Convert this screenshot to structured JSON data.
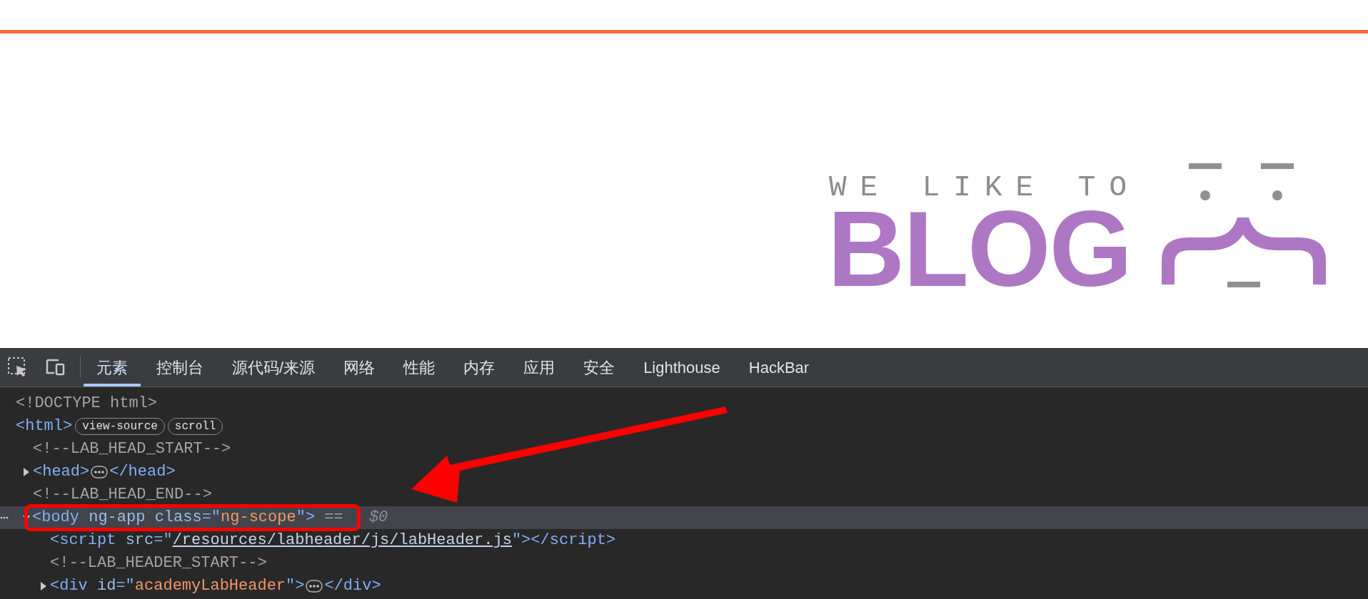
{
  "page": {
    "logo": {
      "tagline": "WE LIKE TO",
      "word": "BLOG"
    }
  },
  "devtools": {
    "tabs": [
      {
        "label": "元素",
        "selected": true
      },
      {
        "label": "控制台",
        "selected": false
      },
      {
        "label": "源代码/来源",
        "selected": false
      },
      {
        "label": "网络",
        "selected": false
      },
      {
        "label": "性能",
        "selected": false
      },
      {
        "label": "内存",
        "selected": false
      },
      {
        "label": "应用",
        "selected": false
      },
      {
        "label": "安全",
        "selected": false
      },
      {
        "label": "Lighthouse",
        "selected": false
      },
      {
        "label": "HackBar",
        "selected": false
      }
    ],
    "dom_tree": [
      {
        "parts": [
          {
            "kind": "comment",
            "text": "<!DOCTYPE html>"
          }
        ]
      },
      {
        "parts": [
          {
            "kind": "tag",
            "text": "<html>"
          },
          {
            "kind": "badge",
            "text": "view-source"
          },
          {
            "kind": "badge",
            "text": "scroll"
          }
        ],
        "children": [
          {
            "parts": [
              {
                "kind": "comment",
                "text": "<!--LAB_HEAD_START-->"
              }
            ]
          },
          {
            "expanded": false,
            "parts": [
              {
                "kind": "tag",
                "text": "<head>"
              },
              {
                "kind": "ellipsis"
              },
              {
                "kind": "tag",
                "text": "</head>"
              }
            ]
          },
          {
            "parts": [
              {
                "kind": "comment",
                "text": "<!--LAB_HEAD_END-->"
              }
            ]
          },
          {
            "expanded": true,
            "selected": true,
            "highlighted": true,
            "parts": [
              {
                "kind": "tag",
                "text": "<body "
              },
              {
                "kind": "attr",
                "text": "ng-app class"
              },
              {
                "kind": "tag",
                "text": "=\""
              },
              {
                "kind": "value",
                "text": "ng-scope"
              },
              {
                "kind": "tag",
                "text": "\">"
              },
              {
                "kind": "comment",
                "text": " == "
              },
              {
                "kind": "ref",
                "text": "$0"
              }
            ],
            "children": [
              {
                "parts": [
                  {
                    "kind": "tag",
                    "text": "<script "
                  },
                  {
                    "kind": "attr",
                    "text": "src"
                  },
                  {
                    "kind": "tag",
                    "text": "=\""
                  },
                  {
                    "kind": "link",
                    "text": "/resources/labheader/js/labHeader.js"
                  },
                  {
                    "kind": "tag",
                    "text": "\"></script>"
                  }
                ]
              },
              {
                "parts": [
                  {
                    "kind": "comment",
                    "text": "<!--LAB_HEADER_START-->"
                  }
                ]
              },
              {
                "expanded": false,
                "parts": [
                  {
                    "kind": "tag",
                    "text": "<div "
                  },
                  {
                    "kind": "attr",
                    "text": "id"
                  },
                  {
                    "kind": "tag",
                    "text": "=\""
                  },
                  {
                    "kind": "value",
                    "text": "academyLabHeader"
                  },
                  {
                    "kind": "tag",
                    "text": "\">"
                  },
                  {
                    "kind": "ellipsis"
                  },
                  {
                    "kind": "tag",
                    "text": "</div>"
                  }
                ]
              }
            ]
          }
        ]
      }
    ]
  }
}
